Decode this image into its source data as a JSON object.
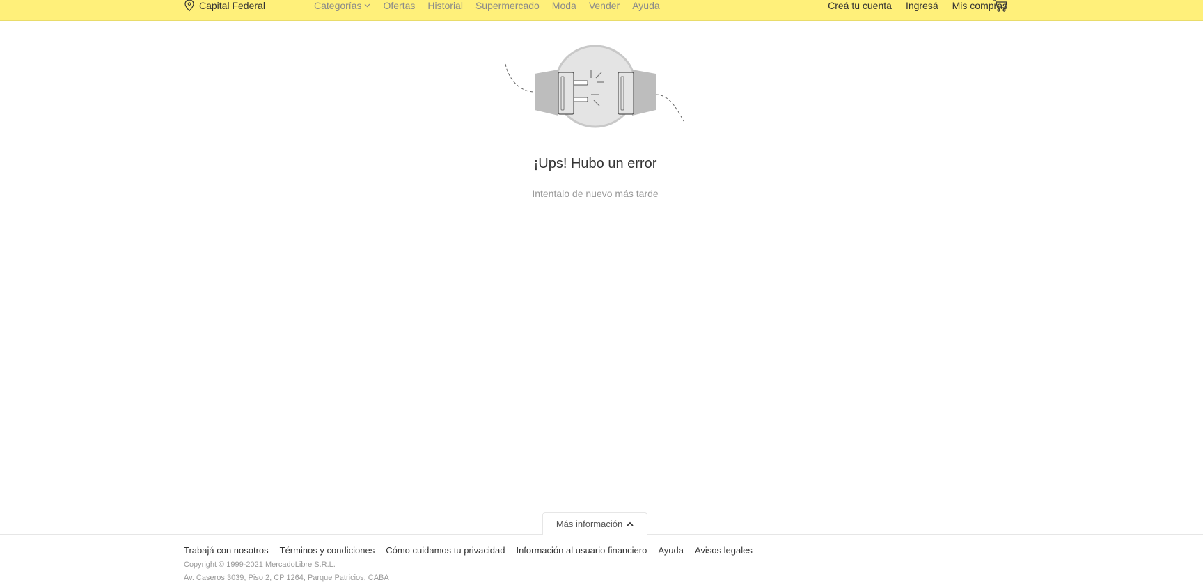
{
  "header": {
    "location": "Capital Federal",
    "nav": [
      "Ofertas",
      "Historial",
      "Supermercado",
      "Moda",
      "Vender",
      "Ayuda"
    ],
    "categories_label": "Categorías",
    "account": {
      "create": "Creá tu cuenta",
      "login": "Ingresá",
      "purchases": "Mis compras"
    },
    "brand_color": "#fff07a"
  },
  "error": {
    "title": "¡Ups! Hubo un error",
    "subtitle": "Intentalo de nuevo más tarde"
  },
  "footer": {
    "more_info": "Más información",
    "links": [
      "Trabajá con nosotros",
      "Términos y condiciones",
      "Cómo cuidamos tu privacidad",
      "Información al usuario financiero",
      "Ayuda",
      "Avisos legales"
    ],
    "copyright": "Copyright © 1999-2021 MercadoLibre S.R.L.",
    "address": "Av. Caseros 3039, Piso 2, CP 1264, Parque Patricios, CABA"
  }
}
